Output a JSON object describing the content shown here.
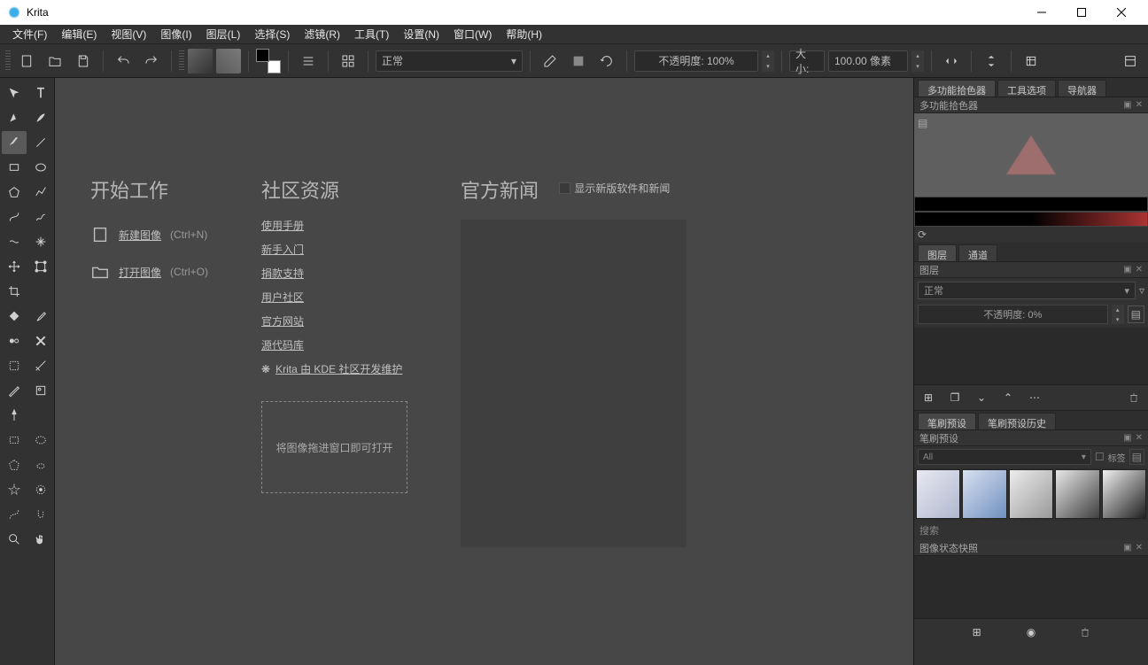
{
  "app": {
    "title": "Krita"
  },
  "menu": {
    "file": "文件(F)",
    "edit": "编辑(E)",
    "view": "视图(V)",
    "image": "图像(I)",
    "layer": "图层(L)",
    "select": "选择(S)",
    "filter": "滤镜(R)",
    "tools": "工具(T)",
    "settings": "设置(N)",
    "window": "窗口(W)",
    "help": "帮助(H)"
  },
  "toolbar": {
    "blend_mode": "正常",
    "opacity_label": "不透明度: 100%",
    "size_label": "大小:",
    "size_value": "100.00 像素"
  },
  "start": {
    "title": "开始工作",
    "new_image": "新建图像",
    "new_shortcut": "(Ctrl+N)",
    "open_image": "打开图像",
    "open_shortcut": "(Ctrl+O)"
  },
  "community": {
    "title": "社区资源",
    "manual": "使用手册",
    "getting_started": "新手入门",
    "donate": "捐款支持",
    "user_community": "用户社区",
    "website": "官方网站",
    "source": "源代码库",
    "kde": "Krita 由 KDE 社区开发维护",
    "drop": "将图像拖进窗口即可打开"
  },
  "news": {
    "title": "官方新闻",
    "checkbox": "显示新版软件和新闻"
  },
  "right": {
    "tab_color": "多功能拾色器",
    "tab_tool_options": "工具选项",
    "tab_navigator": "导航器",
    "color_panel_title": "多功能拾色器",
    "tab_layers": "图层",
    "tab_channels": "通道",
    "layers_title": "图层",
    "layer_blend": "正常",
    "layer_opacity": "不透明度:  0%",
    "tab_brush_presets": "笔刷预设",
    "tab_brush_history": "笔刷预设历史",
    "brush_presets_title": "笔刷预设",
    "brush_filter": "All",
    "brush_tag": "标签",
    "search": "搜索",
    "snapshot_title": "图像状态快照"
  }
}
